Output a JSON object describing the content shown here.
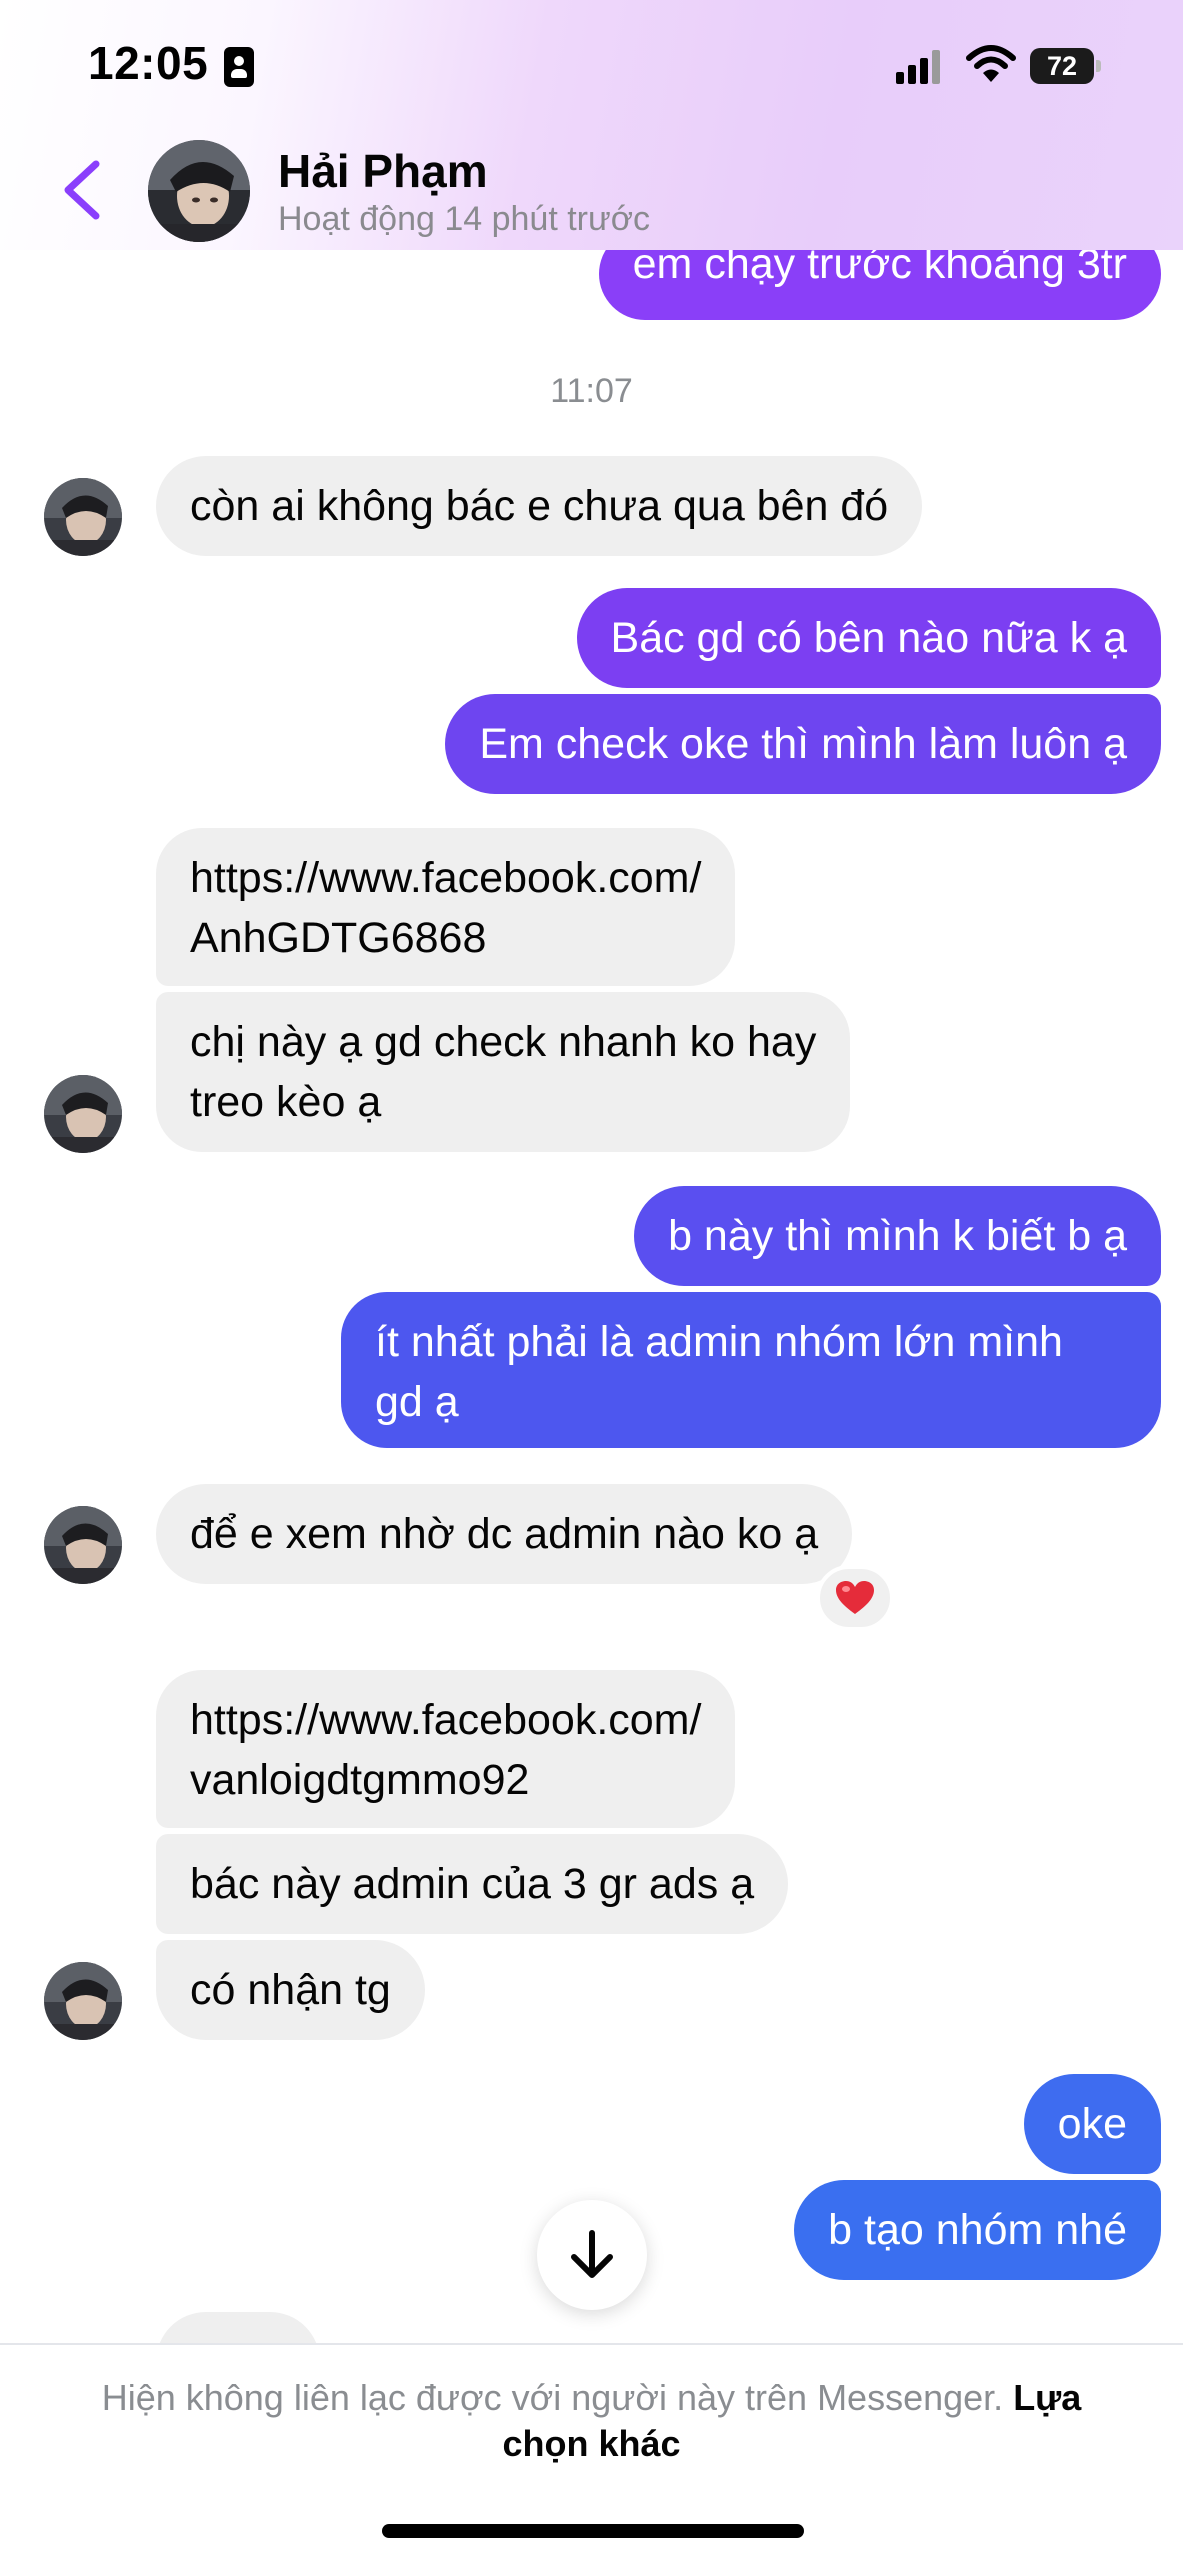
{
  "status_bar": {
    "time": "12:05",
    "battery_level": "72"
  },
  "header": {
    "contact_name": "Hải Phạm",
    "activity_status": "Hoạt động 14 phút trước"
  },
  "conversation": {
    "timestamp": "11:07",
    "messages": [
      {
        "direction": "outgoing",
        "lines": [
          "em chạy trước khoảng 3tr"
        ]
      },
      {
        "direction": "incoming",
        "lines": [
          "còn ai không bác e chưa qua bên đó"
        ]
      },
      {
        "direction": "outgoing",
        "lines": [
          "Bác gd có bên nào nữa k ạ"
        ]
      },
      {
        "direction": "outgoing",
        "lines": [
          "Em check oke thì mình làm luôn ạ"
        ]
      },
      {
        "direction": "incoming",
        "lines": [
          "https://www.facebook.com/",
          "AnhGDTG6868"
        ]
      },
      {
        "direction": "incoming",
        "lines": [
          "chị này ạ gd check nhanh ko hay",
          "treo kèo ạ"
        ]
      },
      {
        "direction": "outgoing",
        "lines": [
          "b này thì mình k biết b ạ"
        ]
      },
      {
        "direction": "outgoing",
        "lines": [
          "ít nhất phải là admin nhóm lớn mình",
          "gd ạ"
        ]
      },
      {
        "direction": "incoming",
        "lines": [
          "để e xem nhờ dc admin nào ko ạ"
        ],
        "reaction": "heart"
      },
      {
        "direction": "incoming",
        "lines": [
          "https://www.facebook.com/",
          "vanloigdtgmmo92"
        ]
      },
      {
        "direction": "incoming",
        "lines": [
          "bác này admin của 3 gr ads ạ"
        ]
      },
      {
        "direction": "incoming",
        "lines": [
          "có nhận tg"
        ]
      },
      {
        "direction": "outgoing",
        "lines": [
          "oke"
        ]
      },
      {
        "direction": "outgoing",
        "lines": [
          "b tạo nhóm nhé"
        ]
      }
    ]
  },
  "footer": {
    "notice": "Hiện không liên lạc được với người này trên Messenger.",
    "link_label": "Lựa chọn khác"
  },
  "colors": {
    "incoming_bubble": "#efefef",
    "outgoing_purple": "#7a3ff0",
    "outgoing_blue": "#3d6cf0",
    "accent_back": "#8a3ffc"
  }
}
